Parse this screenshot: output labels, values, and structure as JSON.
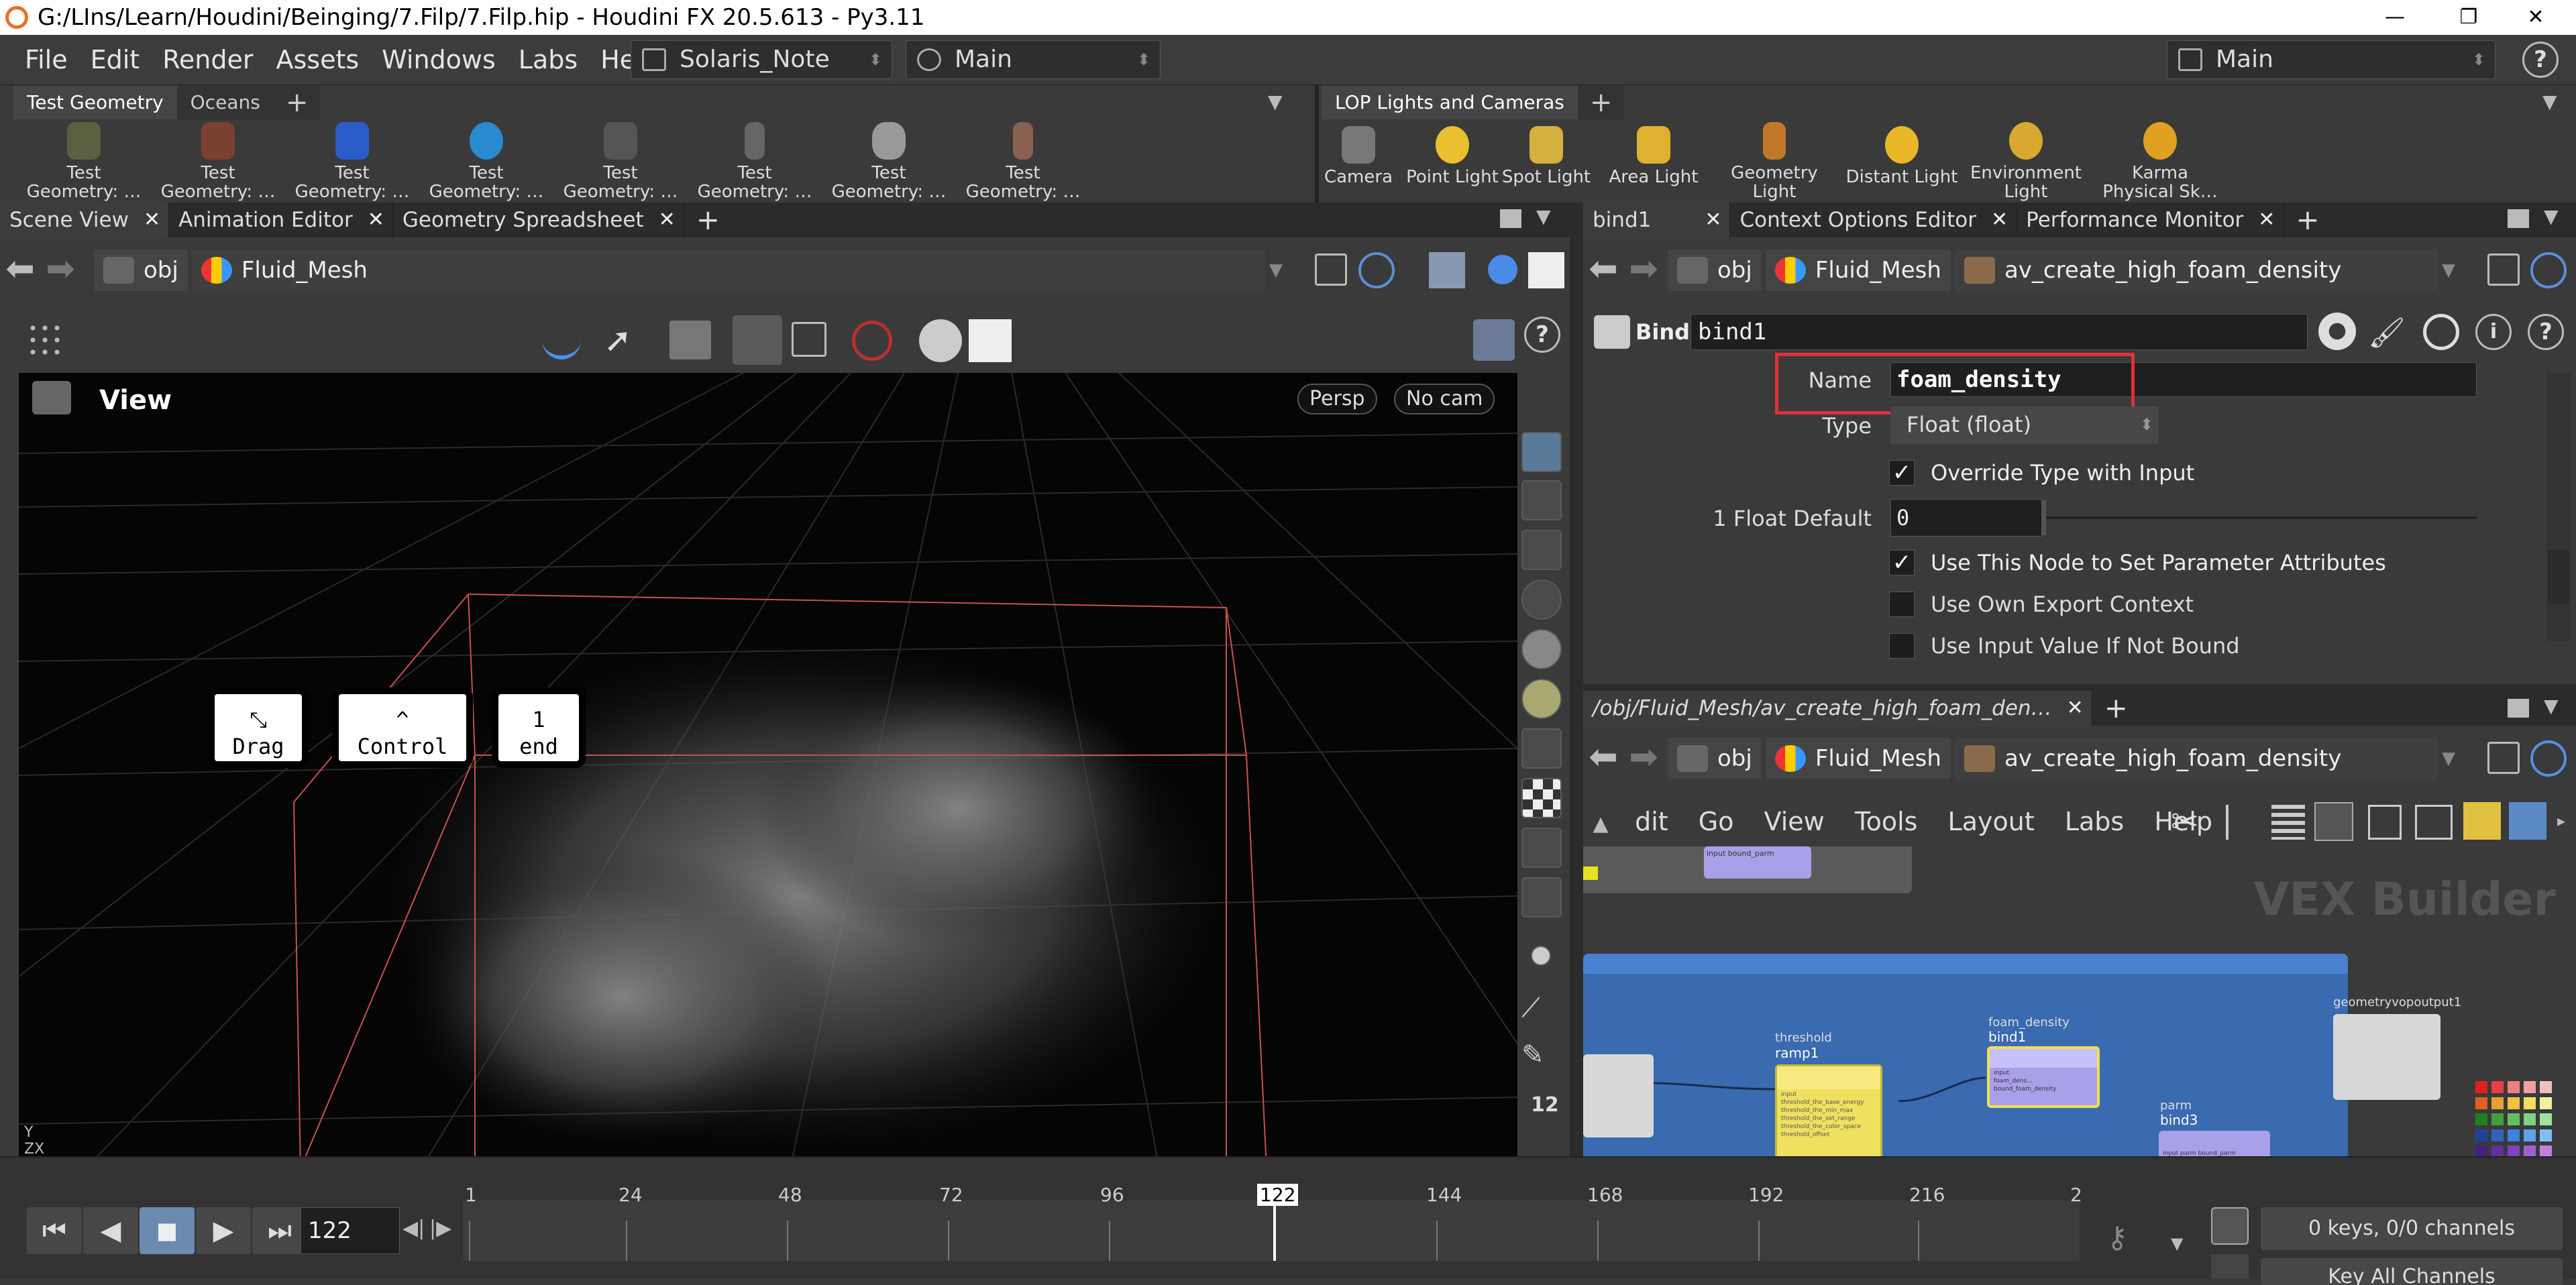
{
  "window": {
    "title": "G:/LIns/Learn/Houdini/Beinging/7.Filp/7.Filp.hip - Houdini FX 20.5.613 - Py3.11",
    "minimize": "—",
    "maximize": "❐",
    "close": "✕"
  },
  "menu": [
    "File",
    "Edit",
    "Render",
    "Assets",
    "Windows",
    "Labs",
    "Help"
  ],
  "desktop_combo": "Solaris_Note",
  "context_combo": "Main",
  "right_combo": "Main",
  "help_glyph": "?",
  "shelf_left": {
    "tabs": [
      "Test Geometry",
      "Oceans"
    ],
    "tools": [
      "Test Geometry: …",
      "Test Geometry: …",
      "Test Geometry: …",
      "Test Geometry: …",
      "Test Geometry: …",
      "Test Geometry: …",
      "Test Geometry: …",
      "Test Geometry: …"
    ]
  },
  "shelf_right": {
    "tabs": [
      "LOP Lights and Cameras"
    ],
    "tools": [
      "Camera",
      "Point Light",
      "Spot Light",
      "Area Light",
      "Geometry Light",
      "Distant Light",
      "Environment Light",
      "Karma Physical Sk…"
    ]
  },
  "left_tabs": [
    "Scene View",
    "Animation Editor",
    "Geometry Spreadsheet"
  ],
  "left_path": {
    "obj": "obj",
    "node": "Fluid_Mesh"
  },
  "viewport": {
    "label": "View",
    "persp": "Persp",
    "cam": "No cam",
    "axis": "Y\nZX"
  },
  "keycaps": [
    {
      "sym": "⤡",
      "label": "Drag"
    },
    {
      "sym": "^",
      "label": "Control"
    },
    {
      "sym": "1",
      "label": "end"
    }
  ],
  "param_tabs": [
    "bind1",
    "Context Options Editor",
    "Performance Monitor"
  ],
  "param_path": {
    "obj": "obj",
    "mesh": "Fluid_Mesh",
    "node": "av_create_high_foam_density"
  },
  "params": {
    "node_type": "Bind",
    "node_name": "bind1",
    "name_label": "Name",
    "name_value": "foam_density",
    "type_label": "Type",
    "type_value": "Float (float)",
    "override_label": "Override Type with Input",
    "default_label": "1 Float Default",
    "default_value": "0",
    "use_node_label": "Use This Node to Set Parameter Attributes",
    "own_export_label": "Use Own Export Context",
    "input_value_label": "Use Input Value If Not Bound"
  },
  "net_tab": "/obj/Fluid_Mesh/av_create_high_foam_den…",
  "net_path": {
    "obj": "obj",
    "mesh": "Fluid_Mesh",
    "node": "av_create_high_foam_density"
  },
  "net_menu": [
    "dit",
    "Go",
    "View",
    "Tools",
    "Layout",
    "Labs",
    "Help"
  ],
  "net": {
    "watermark": "VEX Builder",
    "threshold_label": "threshold",
    "ramp_name": "ramp1",
    "foam_label": "foam_density",
    "bind1_name": "bind1",
    "parm_label": "parm",
    "bind3_name": "bind3",
    "output_name": "geometryvopoutput1",
    "ramp_rows": [
      "input",
      "threshold_the_base_energy",
      "threshold_the_min_max",
      "threshold_the_set_range",
      "threshold_the_color_space",
      "threshold_offset"
    ],
    "bind1_rows": [
      "input",
      "foam_dens…",
      "bound_foam_density"
    ],
    "bind3_rows": [
      "input",
      "parm",
      "bound_parm"
    ],
    "top_rows": [
      "input",
      "bound_parm"
    ]
  },
  "timeline": {
    "frame": "122",
    "ticks": [
      "1",
      "24",
      "48",
      "72",
      "96",
      "122",
      "144",
      "168",
      "192",
      "216",
      "2"
    ],
    "keys_status": "0 keys, 0/0 channels",
    "key_all": "Key All Channels",
    "current_frame_fraction": 0.49
  }
}
